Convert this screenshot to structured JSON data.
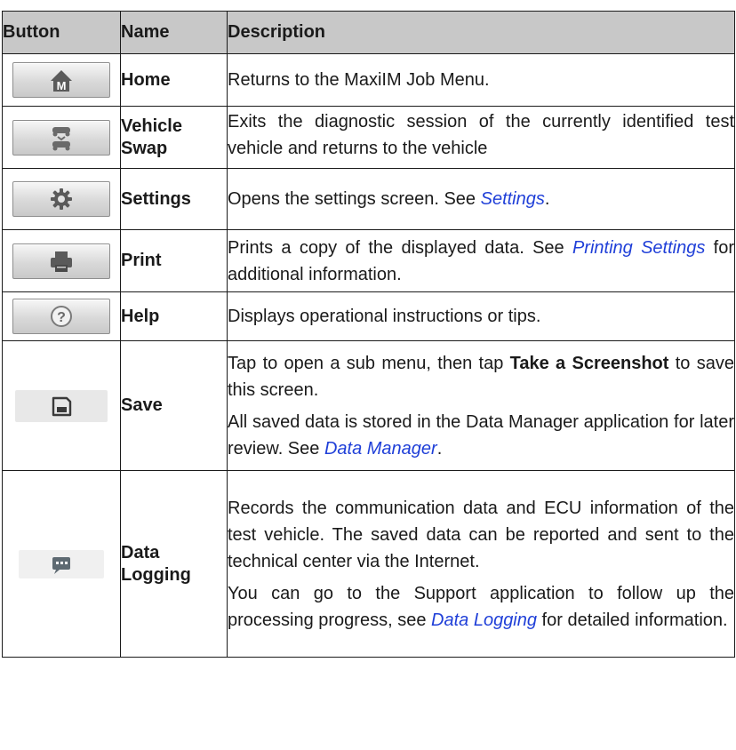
{
  "table": {
    "headers": {
      "button": "Button",
      "name": "Name",
      "description": "Description"
    },
    "rows": [
      {
        "icon": "home-icon",
        "name": "Home",
        "desc": {
          "p1": "Returns to the MaxiIM Job Menu."
        }
      },
      {
        "icon": "vehicle-swap-icon",
        "name_line1": "Vehicle",
        "name_line2": "Swap",
        "desc": {
          "p1": "Exits the diagnostic session of the currently identified test vehicle and returns to the vehicle"
        }
      },
      {
        "icon": "gear-icon",
        "name": "Settings",
        "desc": {
          "p1_pre": "Opens the settings screen. See ",
          "p1_link": "Settings",
          "p1_post": "."
        }
      },
      {
        "icon": "printer-icon",
        "name": "Print",
        "desc": {
          "p1_pre": "Prints a copy of the displayed data. See ",
          "p1_link": "Printing Settings",
          "p1_post": " for additional information."
        }
      },
      {
        "icon": "help-icon",
        "name": "Help",
        "desc": {
          "p1": "Displays operational instructions or tips."
        }
      },
      {
        "icon": "save-icon",
        "name": "Save",
        "desc": {
          "p1_pre": "Tap to open a sub menu, then tap ",
          "p1_bold": "Take a Screenshot",
          "p1_post": " to save this screen.",
          "p2_pre": "All saved data is stored in the Data Manager application for later review. See ",
          "p2_link": "Data Manager",
          "p2_post": "."
        }
      },
      {
        "icon": "data-logging-icon",
        "name_line1": "Data",
        "name_line2": "Logging",
        "desc": {
          "p1": "Records the communication data and ECU information of the test vehicle. The saved data can be reported and sent to the technical center via the Internet.",
          "p2_pre": "You can go to the Support application to follow up the processing progress, see ",
          "p2_link": "Data Logging",
          "p2_post": " for detailed information."
        }
      }
    ]
  },
  "colors": {
    "header_bg": "#c8c8c8",
    "link": "#1f3fd8",
    "border": "#1a1a1a"
  }
}
